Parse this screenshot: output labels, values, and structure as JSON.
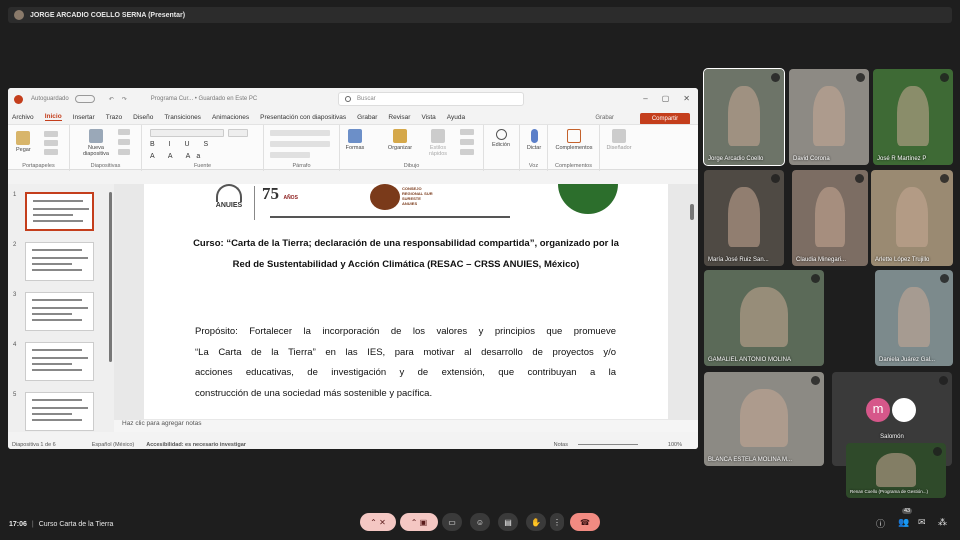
{
  "presenter_bar": {
    "label": "JORGE ARCADIO COELLO SERNA (Presentar)"
  },
  "ppt": {
    "autosave": "Autoguardado",
    "doc_title": "Programa Cur... • Guardado en Este PC",
    "search_placeholder": "Buscar",
    "tabs": [
      "Archivo",
      "Inicio",
      "Insertar",
      "Trazo",
      "Diseño",
      "Transiciones",
      "Animaciones",
      "Presentación con diapositivas",
      "Grabar",
      "Revisar",
      "Vista",
      "Ayuda"
    ],
    "grabar": "Grabar",
    "share": "Compartir",
    "ribbon": {
      "pegar": "Pegar",
      "nueva": "Nueva diapositiva",
      "formas": "Formas",
      "organizar": "Organizar",
      "estilos": "Estilos rápidos",
      "edicion": "Edición",
      "dictar": "Dictar",
      "complementos": "Complementos",
      "disenador": "Diseñador",
      "groups": [
        "Portapapeles",
        "Diapositivas",
        "Fuente",
        "Párrafo",
        "Dibujo",
        "Voz",
        "Complementos"
      ]
    },
    "slide": {
      "course": "Curso: “Carta de la Tierra; declaración de una responsabilidad compartida”, organizado por la Red de Sustentabilidad y Acción Climática (RESAC – CRSS ANUIES, México)",
      "purpose_lines": [
        "Propósito: Fortalecer la incorporación de los valores y principios que promueve",
        "“La Carta de la Tierra” en las IES, para motivar al desarrollo de proyectos y/o",
        "acciones educativas, de investigación y de extensión, que contribuyan a la",
        "construcción de una sociedad más sostenible y pacífica."
      ],
      "logo_anuies": "ANUIES",
      "logo_75": "75",
      "logo_anos": "AÑOS",
      "logo_consejo": "CONSEJO REGIONAL SUR SURESTE ANUIES"
    },
    "notes": "Haz clic para agregar notas",
    "status": {
      "slide": "Diapositiva 1 de 6",
      "lang": "Español (México)",
      "access": "Accesibilidad: es necesario investigar",
      "notas": "Notas",
      "zoom": "100%"
    },
    "thumb_numbers": [
      "1",
      "2",
      "3",
      "4",
      "5"
    ]
  },
  "participants": [
    {
      "name": "Jorge Arcadio Coello"
    },
    {
      "name": "David Corona"
    },
    {
      "name": "José R Martínez P"
    },
    {
      "name": "María José Ruiz San..."
    },
    {
      "name": "Claudia Minegari..."
    },
    {
      "name": "Arlette López Trujillo"
    },
    {
      "name": "GAMALIEL ANTONIO MOLINA"
    },
    {
      "name": "Daniela Juárez Gal..."
    },
    {
      "name": "BLANCA ESTELA MOLINA M..."
    },
    {
      "name": "Salomón",
      "avatar_letter": "m"
    },
    {
      "name": "Renan Coello (Programa de Gestión...)"
    }
  ],
  "bottom_bar": {
    "time": "17:06",
    "meeting": "Curso Carta de la Tierra",
    "participant_count": "43"
  },
  "colors": {
    "ppt_accent": "#c43e1c",
    "meet_red": "#f28b82"
  }
}
